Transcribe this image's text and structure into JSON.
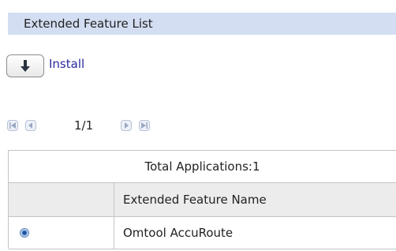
{
  "header": {
    "title": "Extended Feature List"
  },
  "toolbar": {
    "install_label": "Install"
  },
  "pagination": {
    "page_indicator": "1/1"
  },
  "table": {
    "summary_label": "Total Applications",
    "summary_count": "1",
    "columns": [
      "",
      "Extended Feature Name"
    ],
    "rows": [
      {
        "selected": true,
        "name": "Omtool AccuRoute"
      }
    ]
  }
}
